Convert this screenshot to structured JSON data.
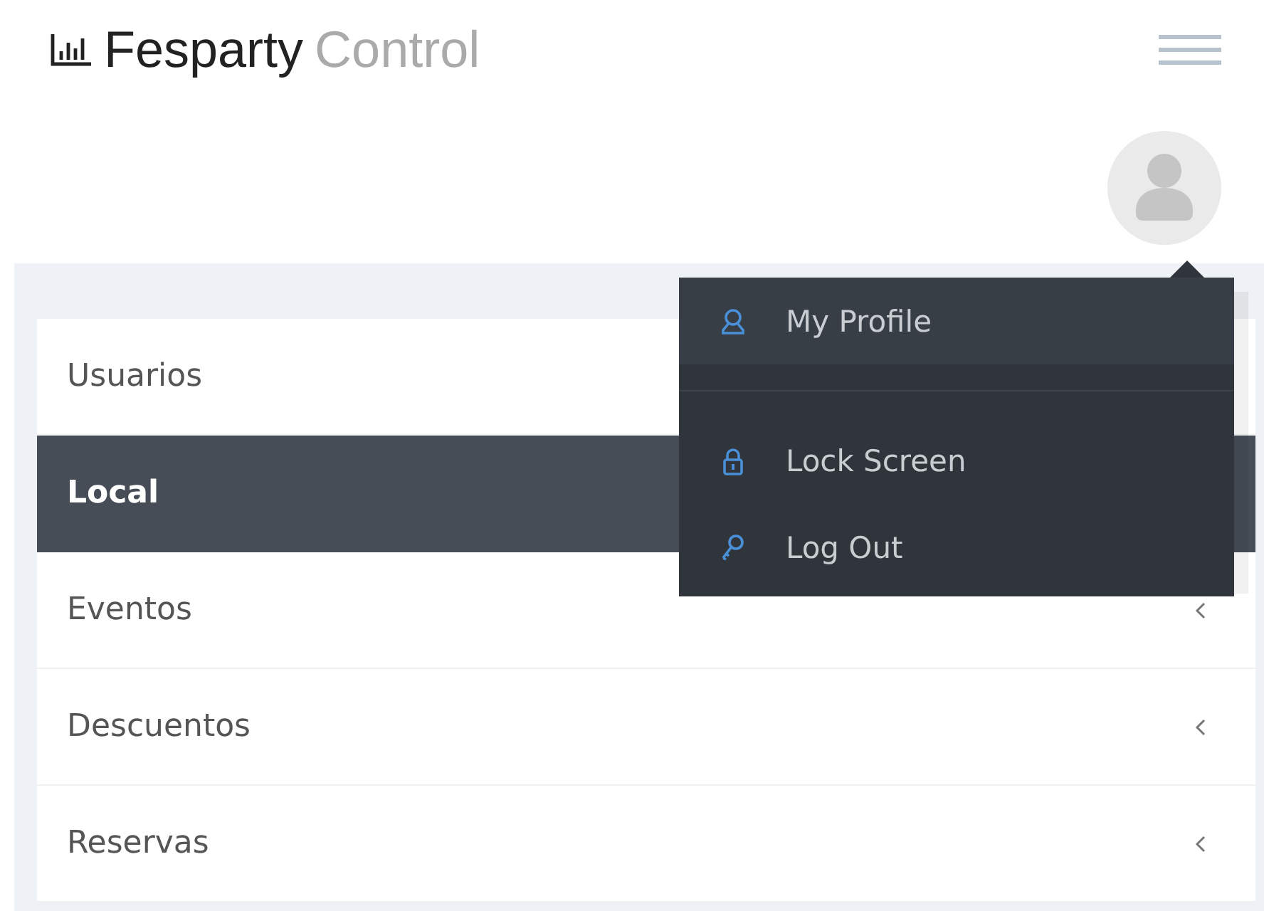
{
  "brand": {
    "name": "Fesparty",
    "suffix": "Control"
  },
  "menu": [
    {
      "label": "Usuarios",
      "selected": false
    },
    {
      "label": "Local",
      "selected": true
    },
    {
      "label": "Eventos",
      "selected": false,
      "arrow": true
    },
    {
      "label": "Descuentos",
      "selected": false,
      "arrow": true
    },
    {
      "label": "Reservas",
      "selected": false,
      "arrow": true
    }
  ],
  "dropdown": {
    "items": [
      {
        "kind": "profile",
        "label": "My Profile"
      },
      {
        "kind": "divider"
      },
      {
        "kind": "lock",
        "label": "Lock Screen"
      },
      {
        "kind": "logout",
        "label": "Log Out"
      }
    ]
  }
}
